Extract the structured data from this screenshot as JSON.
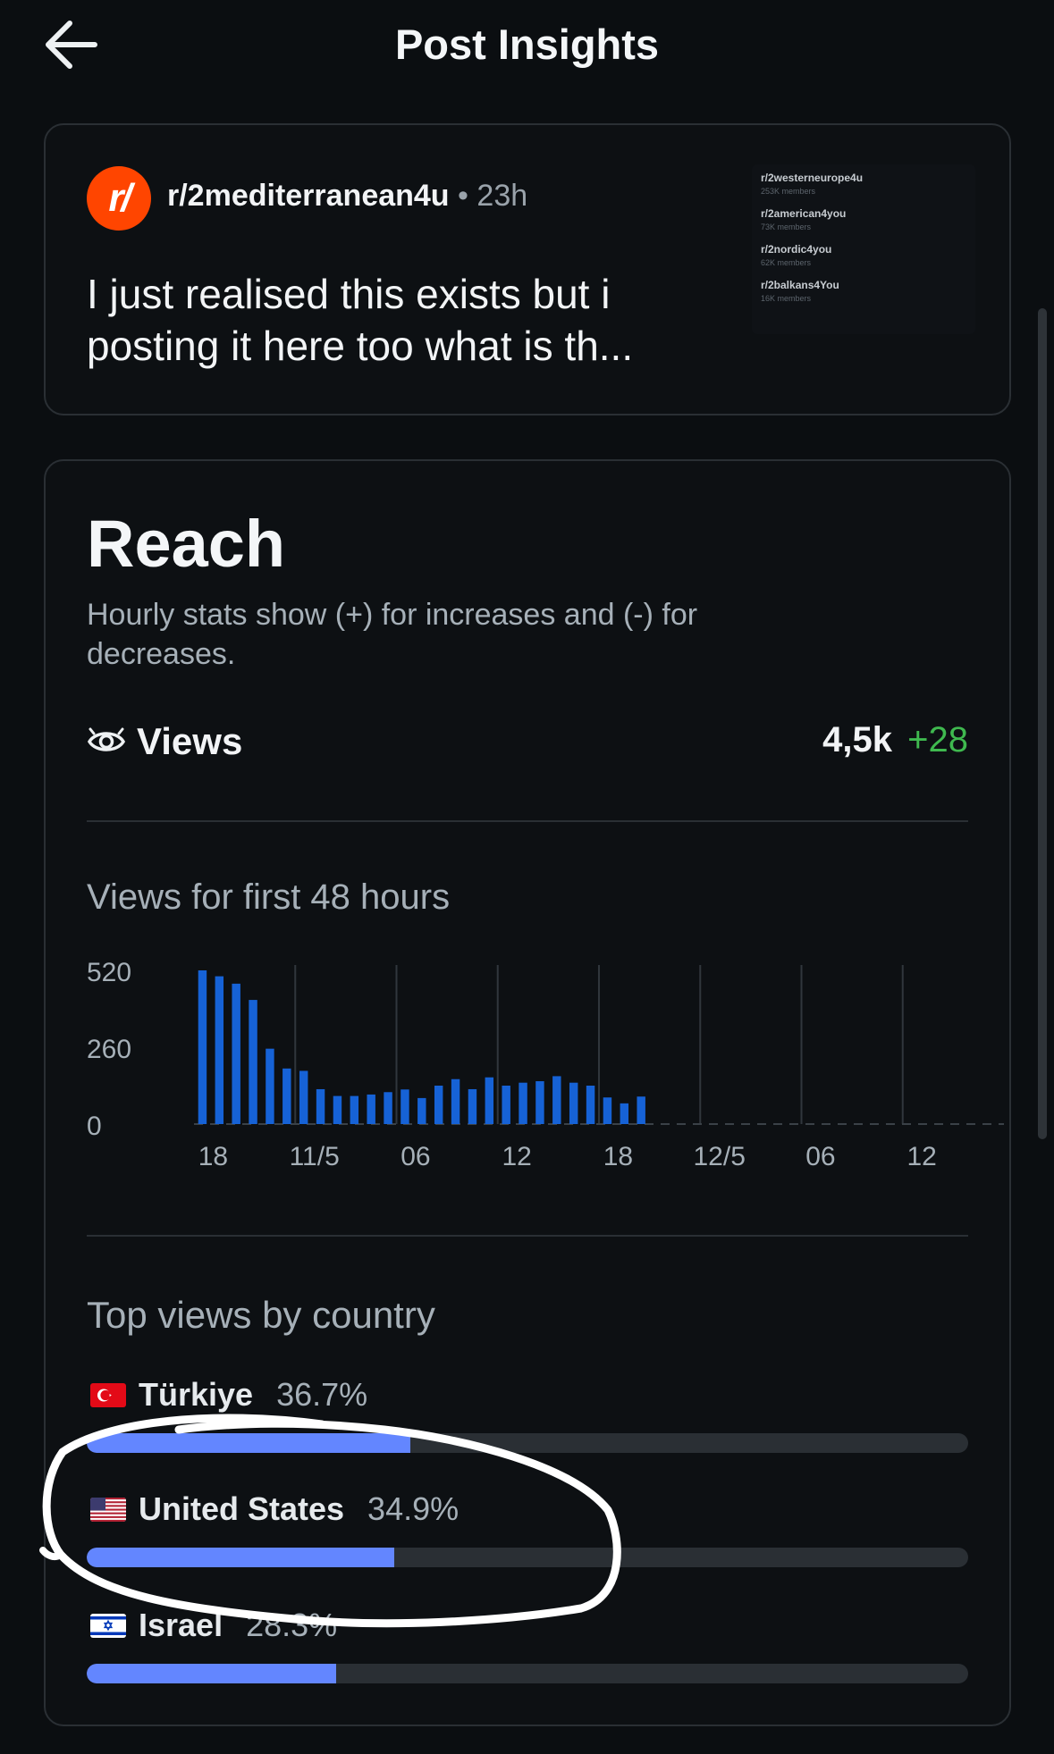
{
  "header": {
    "title": "Post Insights",
    "back_icon": "arrow-left-icon"
  },
  "post": {
    "subreddit": "r/2mediterranean4u",
    "separator": "•",
    "time": "23h",
    "title": "I just realised this exists but i posting it here too what is th...",
    "icon": "subreddit-icon",
    "thumbnail": [
      {
        "name": "r/2westerneurope4u",
        "members": "253K members"
      },
      {
        "name": "r/2american4you",
        "members": "73K members"
      },
      {
        "name": "r/2nordic4you",
        "members": "62K members"
      },
      {
        "name": "r/2balkans4You",
        "members": "16K members"
      }
    ]
  },
  "reach": {
    "title": "Reach",
    "description": "Hourly stats show (+) for increases and (-) for decreases.",
    "views_label": "Views",
    "views_total": "4,5k",
    "views_delta": "+28",
    "chart_title": "Views for first 48 hours",
    "countries_title": "Top views by country"
  },
  "chart_data": {
    "type": "bar",
    "title": "Views for first 48 hours",
    "xlabel": "",
    "ylabel": "",
    "x": [
      1,
      2,
      3,
      4,
      5,
      6,
      7,
      8,
      9,
      10,
      11,
      12,
      13,
      14,
      15,
      16,
      17,
      18,
      19,
      20,
      21,
      22,
      23,
      24,
      25,
      26,
      27,
      28,
      29,
      30,
      31,
      32,
      33,
      34,
      35,
      36,
      37,
      38,
      39,
      40,
      41,
      42,
      43,
      44,
      45,
      46,
      47,
      48
    ],
    "values": [
      520,
      500,
      475,
      420,
      255,
      188,
      180,
      118,
      95,
      95,
      100,
      108,
      117,
      88,
      130,
      152,
      118,
      158,
      130,
      140,
      145,
      162,
      140,
      130,
      90,
      70,
      93,
      0,
      0,
      0,
      0,
      0,
      0,
      0,
      0,
      0,
      0,
      0,
      0,
      0,
      0,
      0,
      0,
      0,
      0,
      0,
      0,
      0
    ],
    "y_ticks": [
      "520",
      "260",
      "0"
    ],
    "x_ticks": [
      "18",
      "11/5",
      "06",
      "12",
      "18",
      "12/5",
      "06",
      "12"
    ],
    "ylim": [
      0,
      520
    ],
    "grid": "vertical",
    "color": "#1662d6"
  },
  "countries": [
    {
      "name": "Türkiye",
      "percent": "36.7%",
      "value": 36.7,
      "flag": "turkey-flag-icon"
    },
    {
      "name": "United States",
      "percent": "34.9%",
      "value": 34.9,
      "flag": "usa-flag-icon"
    },
    {
      "name": "Israel",
      "percent": "28.3%",
      "value": 28.3,
      "flag": "israel-flag-icon"
    }
  ],
  "colors": {
    "background": "#0b0e11",
    "accent_bar": "#6386ff",
    "positive": "#3fb94f",
    "chart_bar": "#1662d6",
    "brand": "#ff4500"
  }
}
